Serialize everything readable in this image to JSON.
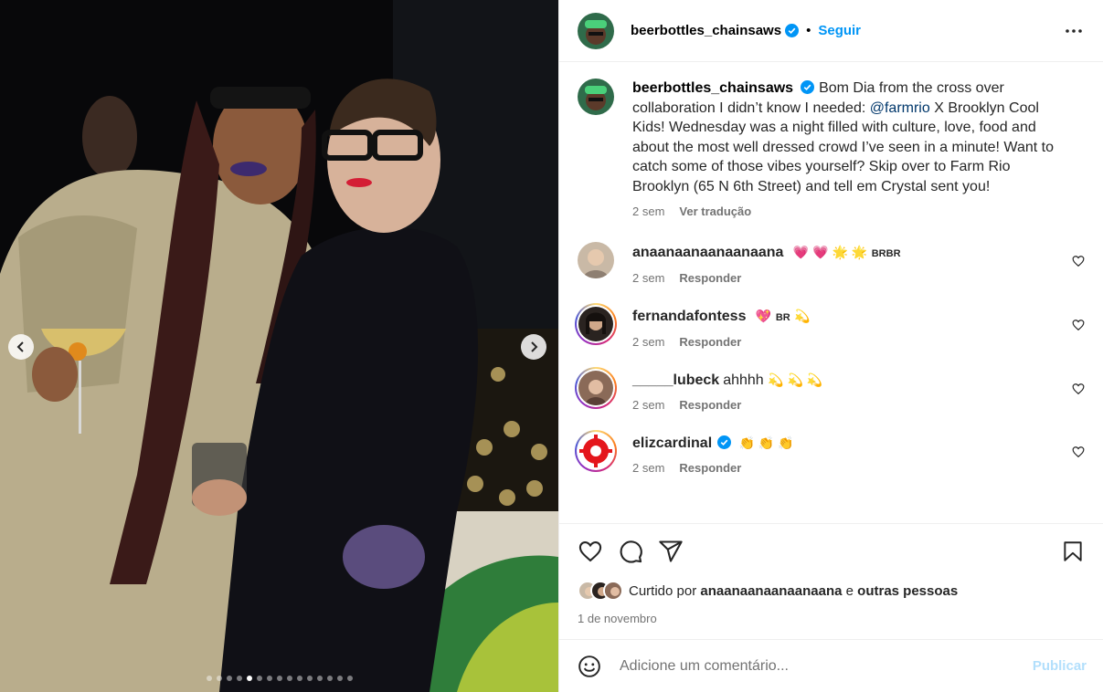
{
  "post": {
    "author": "beerbottles_chainsaws",
    "follow_label": "Seguir",
    "separator": "•",
    "more_icon": "more-horizontal-icon"
  },
  "caption": {
    "author": "beerbottles_chainsaws",
    "text_before": "Bom Dia from the cross over collaboration I didn’t know I needed: ",
    "mention": "@farmrio",
    "text_after": " X Brooklyn Cool Kids! Wednesday was a night filled with culture, love, food and about the most well dressed crowd I’ve seen in a minute! Want to catch some of those vibes yourself? Skip over to Farm Rio Brooklyn (65 N 6th Street) and tell em Crystal sent you!",
    "time": "2 sem",
    "translate_label": "Ver tradução"
  },
  "comments": [
    {
      "user": "anaanaanaanaanaana",
      "emojis": "💗 💗 🌟 🌟",
      "tag": "BRBR",
      "tail": "",
      "time": "2 sem",
      "reply": "Responder"
    },
    {
      "user": "fernandafontess",
      "emojis": "💖",
      "tag": "BR",
      "tail": "💫",
      "time": "2 sem",
      "reply": "Responder"
    },
    {
      "user": "_____lubeck",
      "text": "ahhhh",
      "emojis": "💫 💫 💫",
      "time": "2 sem",
      "reply": "Responder"
    },
    {
      "user": "elizcardinal",
      "emojis": "👏 👏 👏",
      "time": "2 sem",
      "reply": "Responder"
    }
  ],
  "likes": {
    "prefix": "Curtido por",
    "user": "anaanaanaanaanaana",
    "conj": "e",
    "others": "outras pessoas"
  },
  "date": "1 de novembro",
  "add_comment": {
    "placeholder": "Adicione um comentário...",
    "publish": "Publicar"
  },
  "carousel": {
    "count": 15,
    "active_index": 4
  },
  "colors": {
    "accent": "#0095f6",
    "publish_disabled": "#b2dffc",
    "verified": "#0095f6"
  }
}
